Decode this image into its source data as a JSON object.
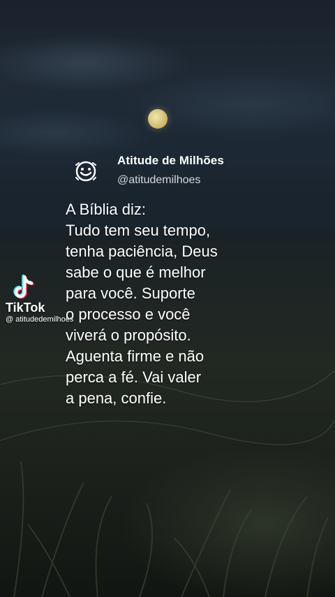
{
  "header": {
    "account_name": "Atitude de Milhões",
    "account_handle": "@atitudemilhoes",
    "avatar_icon": "smiley-icon"
  },
  "quote": {
    "lines": [
      "A Bíblia diz:",
      "Tudo tem seu tempo,",
      "tenha paciência, Deus",
      "sabe o que é melhor",
      "para você. Suporte",
      "o processo e você",
      "viverá o propósito.",
      "Aguenta firme e não",
      "perca a fé. Vai valer",
      "a pena, confie."
    ]
  },
  "watermark": {
    "brand": "TikTok",
    "username": "@ atitudedemilhoes",
    "logo_icon": "tiktok-logo-icon"
  },
  "colors": {
    "moon": "#d9c37a",
    "text": "#ffffff",
    "tiktok_cyan": "#25f4ee",
    "tiktok_red": "#fe2c55"
  }
}
